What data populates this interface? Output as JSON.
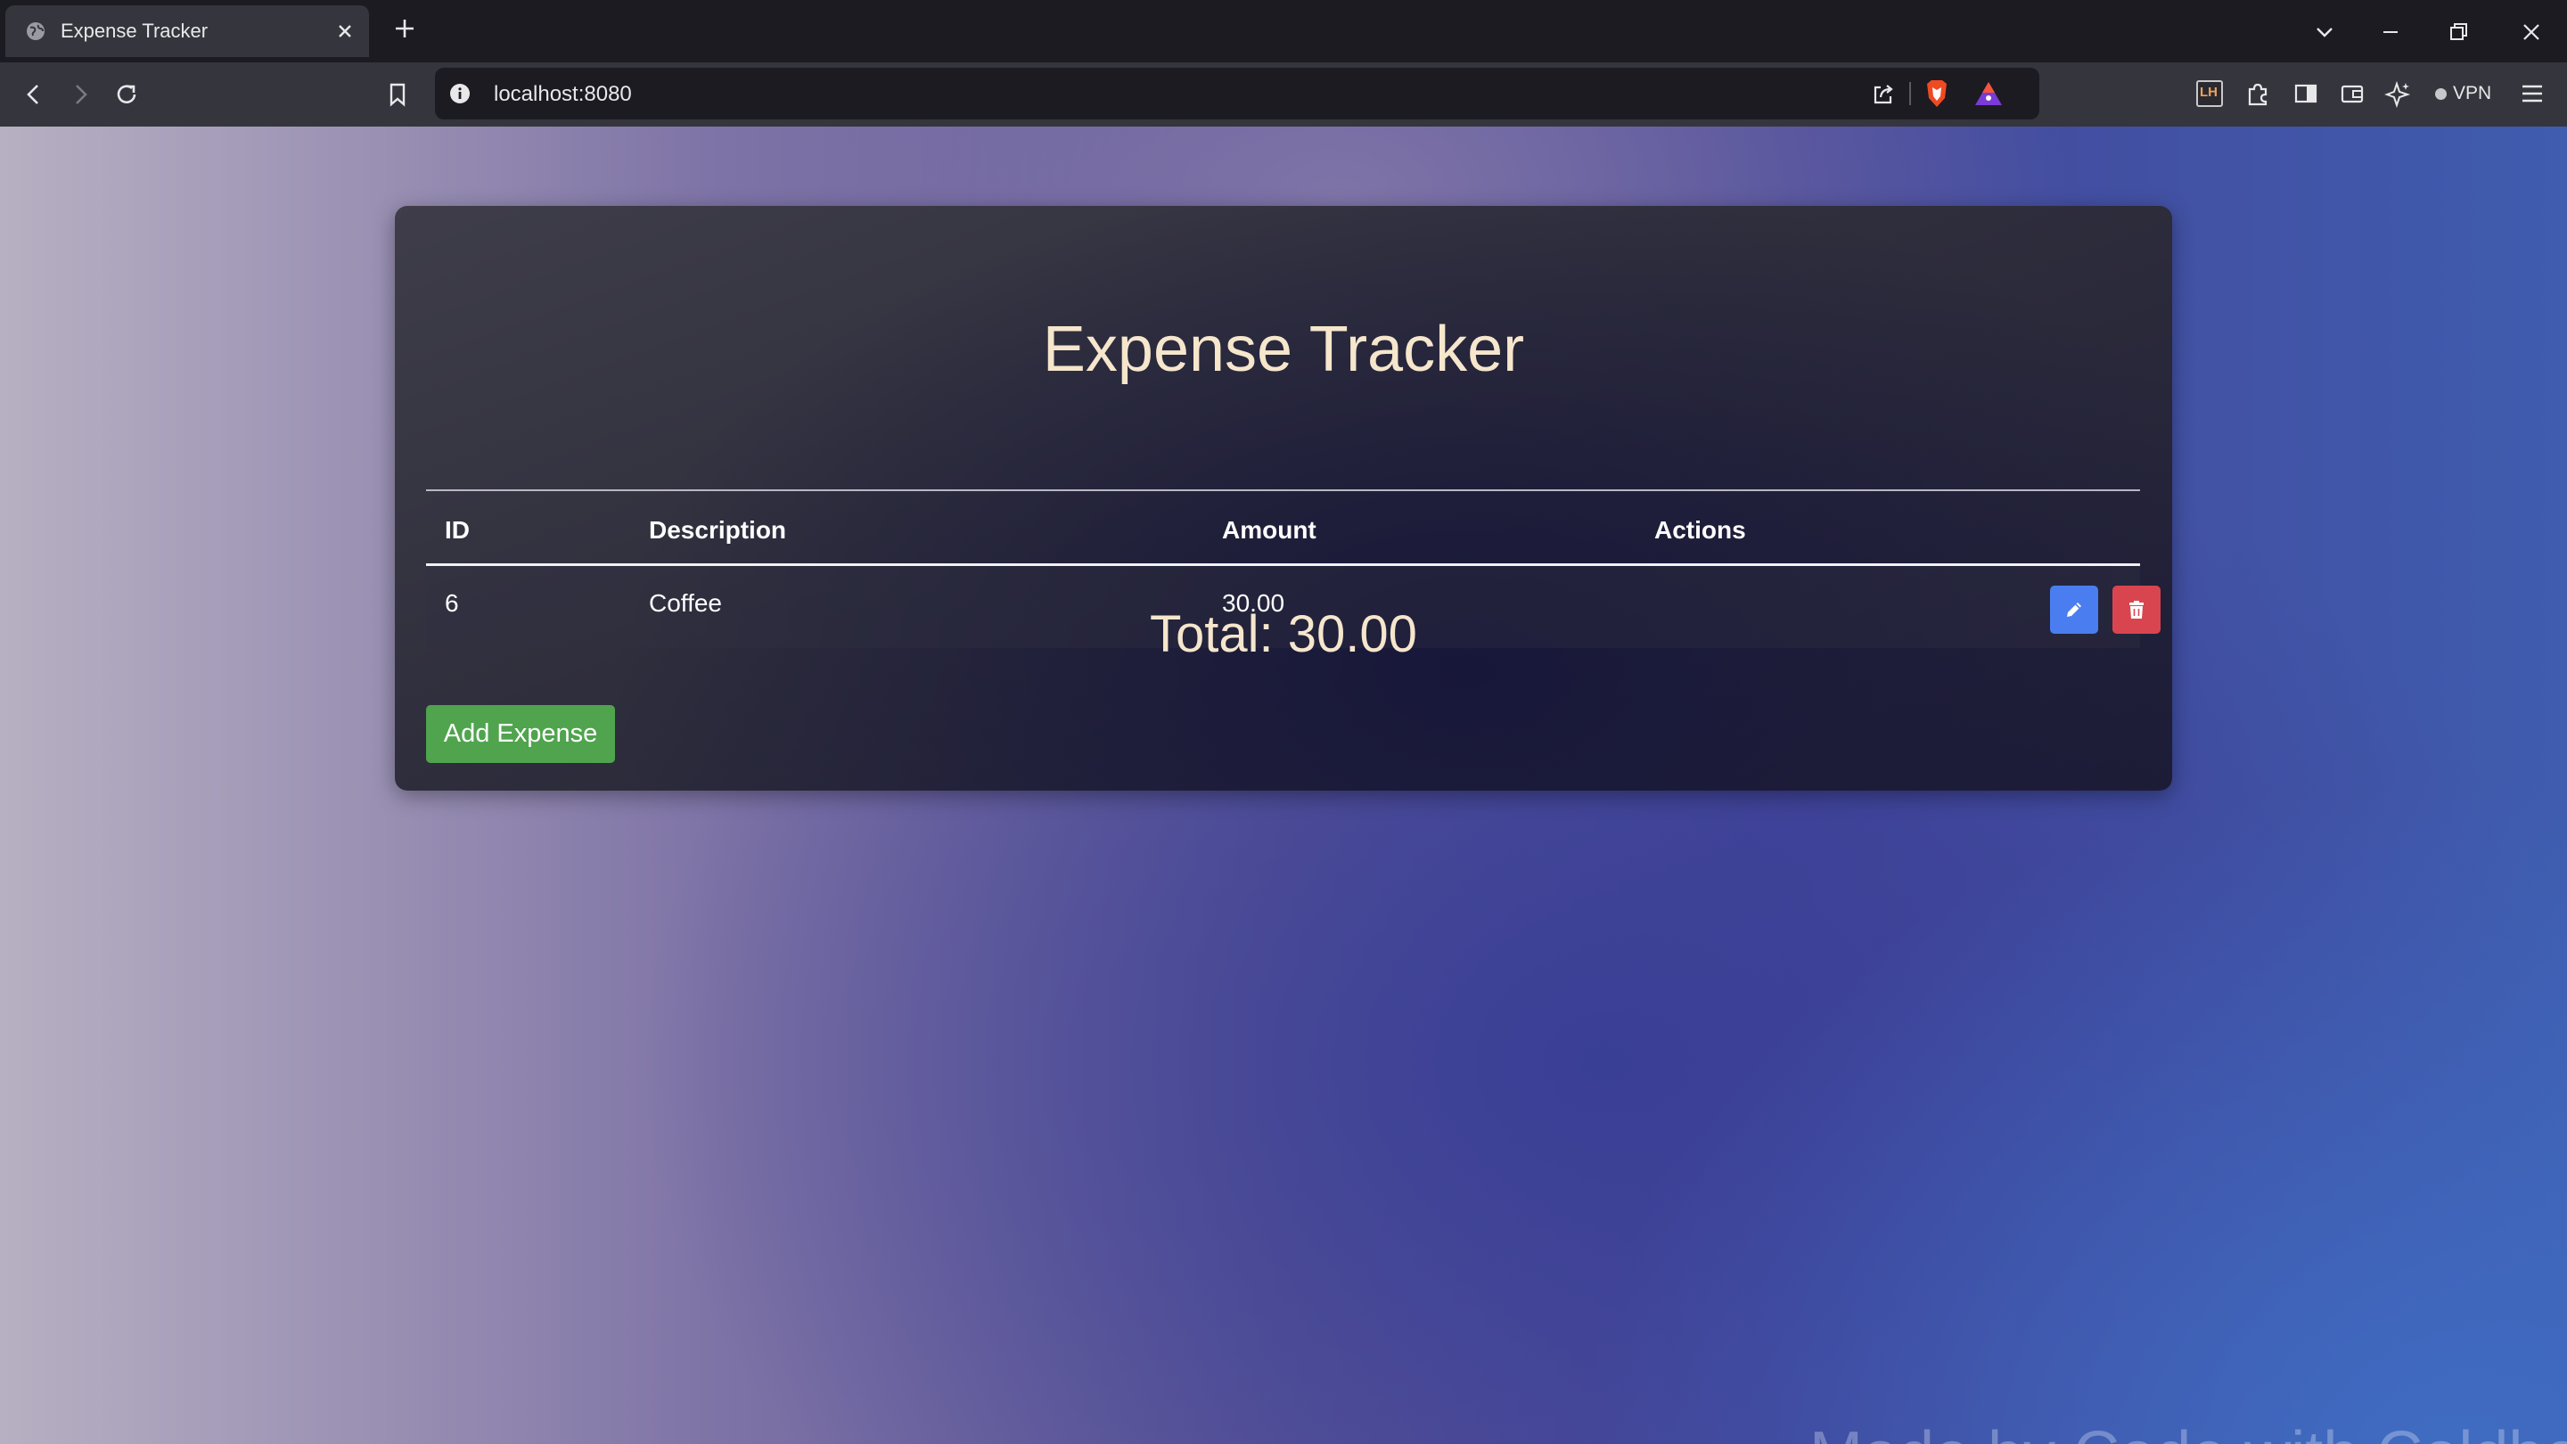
{
  "browser": {
    "tab": {
      "title": "Expense Tracker",
      "favicon": "globe-icon"
    },
    "url": "localhost:8080",
    "vpn_label": "VPN",
    "extension_badge": "LH",
    "icons": [
      "back-icon",
      "forward-icon",
      "reload-icon",
      "bookmark-icon",
      "info-icon",
      "share-icon",
      "brave-shields-icon",
      "brave-rewards-icon",
      "extensions-icon",
      "sidebar-icon",
      "wallet-icon",
      "leo-ai-icon",
      "menu-icon",
      "tab-search-icon",
      "minimize-icon",
      "restore-icon",
      "close-icon"
    ]
  },
  "app": {
    "title": "Expense Tracker",
    "table": {
      "headers": [
        "ID",
        "Description",
        "Amount",
        "Actions"
      ],
      "rows": [
        {
          "id": "6",
          "description": "Coffee",
          "amount": "30.00"
        }
      ]
    },
    "total": "Total: 30.00",
    "add_button": "Add Expense"
  },
  "watermark": "Made by Code with Coldberrot",
  "colors": {
    "accent_title": "#f5e6cc",
    "edit_button": "#4a7ef0",
    "delete_button": "#d9454f",
    "add_button": "#4fa44d"
  }
}
